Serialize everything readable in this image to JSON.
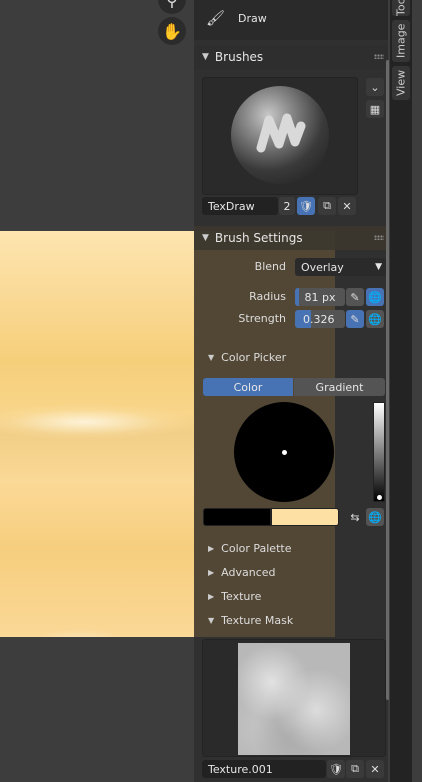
{
  "tool": {
    "label": "Draw",
    "icon": "brush-icon"
  },
  "brushes": {
    "header": "Brushes",
    "brush_name": "TexDraw",
    "user_count": "2"
  },
  "brush_settings": {
    "header": "Brush Settings",
    "blend_label": "Blend",
    "blend_value": "Overlay",
    "radius_label": "Radius",
    "radius_value": "81 px",
    "strength_label": "Strength",
    "strength_value": "0.326",
    "strength_fraction": 0.326
  },
  "color_picker": {
    "header": "Color Picker",
    "tab_color": "Color",
    "tab_gradient": "Gradient",
    "primary_color": "#000000",
    "secondary_color": "#fde0a4"
  },
  "collapsed_panels": [
    "Color Palette",
    "Advanced",
    "Texture"
  ],
  "texture_mask": {
    "header": "Texture Mask",
    "texture_name": "Texture.001"
  },
  "side_tabs": [
    "Tool",
    "Image",
    "View"
  ],
  "colors": {
    "accent": "#4772b3",
    "panel_bg": "#303030",
    "field_bg": "#545454"
  }
}
